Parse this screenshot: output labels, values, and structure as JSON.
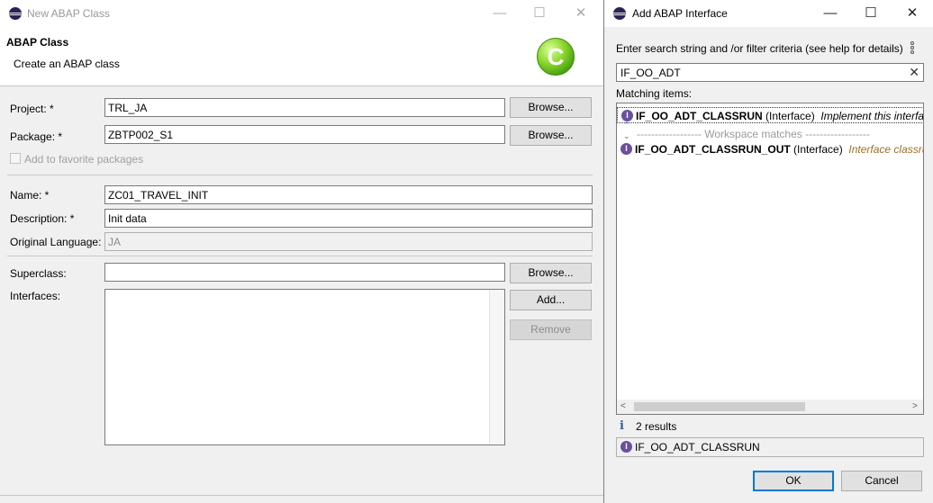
{
  "main_dialog": {
    "window_title": "New ABAP Class",
    "header_title": "ABAP Class",
    "header_subtitle": "Create an ABAP class",
    "logo_letter": "C",
    "minimize": "—",
    "maximize": "☐",
    "close": "✕",
    "project_label": "Project: *",
    "project_value": "TRL_JA",
    "package_label": "Package: *",
    "package_value": "ZBTP002_S1",
    "browse_label": "Browse...",
    "favorite_label": "Add to favorite packages",
    "name_label": "Name: *",
    "name_value": "ZC01_TRAVEL_INIT",
    "description_label": "Description: *",
    "description_value": "Init data",
    "language_label": "Original Language:",
    "language_value": "JA",
    "superclass_label": "Superclass:",
    "superclass_value": "",
    "interfaces_label": "Interfaces:",
    "add_label": "Add...",
    "remove_label": "Remove"
  },
  "interface_dialog": {
    "window_title": "Add ABAP Interface",
    "minimize": "—",
    "maximize": "☐",
    "close": "✕",
    "search_hint": "Enter search string and /or filter criteria (see help for details)",
    "search_value": "IF_OO_ADT",
    "clear_icon": "✕",
    "matching_label": "Matching items:",
    "icon_letter": "I",
    "items": [
      {
        "name": "IF_OO_ADT_CLASSRUN",
        "type": "(Interface)",
        "description": "Implement this interface to"
      },
      {
        "name": "IF_OO_ADT_CLASSRUN_OUT",
        "type": "(Interface)",
        "description": "Interface classrun"
      }
    ],
    "workspace_separator": "------------------ Workspace matches ------------------",
    "info_icon": "i",
    "results_count": "2 results",
    "selected_item": "IF_OO_ADT_CLASSRUN",
    "ok_label": "OK",
    "cancel_label": "Cancel"
  }
}
